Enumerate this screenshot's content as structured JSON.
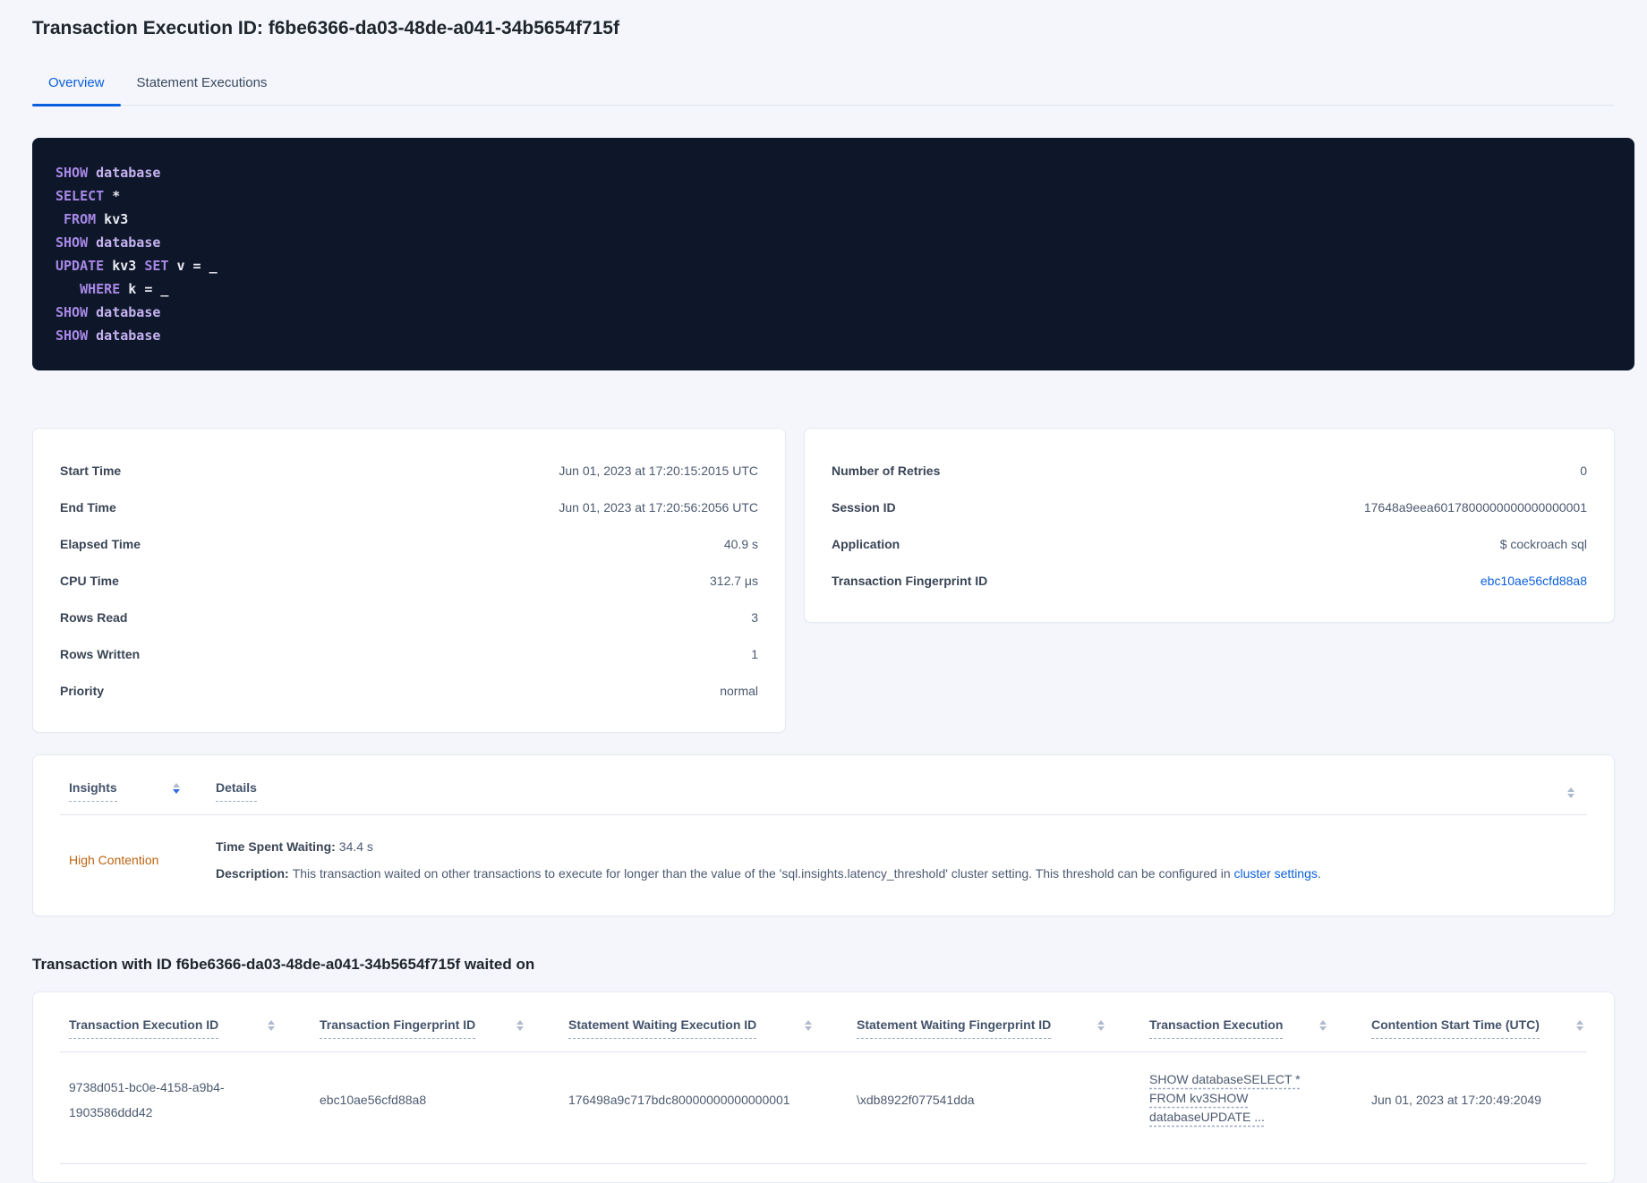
{
  "header": {
    "title": "Transaction Execution ID: f6be6366-da03-48de-a041-34b5654f715f"
  },
  "tabs": {
    "overview": "Overview",
    "statement_executions": "Statement Executions"
  },
  "colors": {
    "accent_blue": "#0b5fdd",
    "insight_orange": "#bd6412",
    "code_background": "#0d1729",
    "code_keyword": "#a888e6",
    "code_keyword_light": "#c7b2f1",
    "code_identifier": "#e9eaf2"
  },
  "sql_box": {
    "lines": [
      [
        {
          "t": "SHOW",
          "c": "kw"
        },
        {
          "t": " ",
          "c": "id"
        },
        {
          "t": "database",
          "c": "kw2"
        }
      ],
      [
        {
          "t": "SELECT",
          "c": "kw"
        },
        {
          "t": " *",
          "c": "id"
        }
      ],
      [
        {
          "t": " ",
          "c": "id"
        },
        {
          "t": "FROM",
          "c": "kw"
        },
        {
          "t": " kv3",
          "c": "id"
        }
      ],
      [
        {
          "t": "SHOW",
          "c": "kw"
        },
        {
          "t": " ",
          "c": "id"
        },
        {
          "t": "database",
          "c": "kw2"
        }
      ],
      [
        {
          "t": "UPDATE",
          "c": "kw"
        },
        {
          "t": " kv3 ",
          "c": "id"
        },
        {
          "t": "SET",
          "c": "kw"
        },
        {
          "t": " v = _",
          "c": "id"
        }
      ],
      [
        {
          "t": "   ",
          "c": "id"
        },
        {
          "t": "WHERE",
          "c": "kw"
        },
        {
          "t": " k = _",
          "c": "id"
        }
      ],
      [
        {
          "t": "SHOW",
          "c": "kw"
        },
        {
          "t": " ",
          "c": "id"
        },
        {
          "t": "database",
          "c": "kw2"
        }
      ],
      [
        {
          "t": "SHOW",
          "c": "kw"
        },
        {
          "t": " ",
          "c": "id"
        },
        {
          "t": "database",
          "c": "kw2"
        }
      ]
    ]
  },
  "summary_left": {
    "rows": [
      {
        "label": "Start Time",
        "value": "Jun 01, 2023 at 17:20:15:2015 UTC"
      },
      {
        "label": "End Time",
        "value": "Jun 01, 2023 at 17:20:56:2056 UTC"
      },
      {
        "label": "Elapsed Time",
        "value": "40.9 s"
      },
      {
        "label": "CPU Time",
        "value": "312.7 μs"
      },
      {
        "label": "Rows Read",
        "value": "3"
      },
      {
        "label": "Rows Written",
        "value": "1"
      },
      {
        "label": "Priority",
        "value": "normal"
      }
    ]
  },
  "summary_right": {
    "rows": [
      {
        "label": "Number of Retries",
        "value": "0"
      },
      {
        "label": "Session ID",
        "value": "17648a9eea6017800000000000000001"
      },
      {
        "label": "Application",
        "value": "$ cockroach sql"
      },
      {
        "label": "Transaction Fingerprint ID",
        "value": "ebc10ae56cfd88a8"
      }
    ]
  },
  "insights_table": {
    "columns": {
      "insights": "Insights",
      "details": "Details"
    },
    "row": {
      "insight": "High Contention",
      "waiting_label": "Time Spent Waiting:",
      "waiting_value": "34.4 s",
      "description_label": "Description:",
      "description_text": "This transaction waited on other transactions to execute for longer than the value of the 'sql.insights.latency_threshold' cluster setting. This threshold can be configured in ",
      "description_link": "cluster settings",
      "description_suffix": "."
    }
  },
  "waited_on": {
    "heading": "Transaction with ID f6be6366-da03-48de-a041-34b5654f715f waited on",
    "columns": [
      "Transaction Execution ID",
      "Transaction Fingerprint ID",
      "Statement Waiting Execution ID",
      "Statement Waiting Fingerprint ID",
      "Transaction Execution",
      "Contention Start Time (UTC)"
    ],
    "row": {
      "transaction_execution_id": "9738d051-bc0e-4158-a9b4-1903586ddd42",
      "transaction_fingerprint_id": "ebc10ae56cfd88a8",
      "statement_waiting_execution_id": "176498a9c717bdc80000000000000001",
      "statement_waiting_fingerprint_id": "\\xdb8922f077541dda",
      "transaction_execution": "SHOW databaseSELECT * FROM kv3SHOW databaseUPDATE ...",
      "contention_start_time": "Jun 01, 2023 at 17:20:49:2049"
    }
  }
}
